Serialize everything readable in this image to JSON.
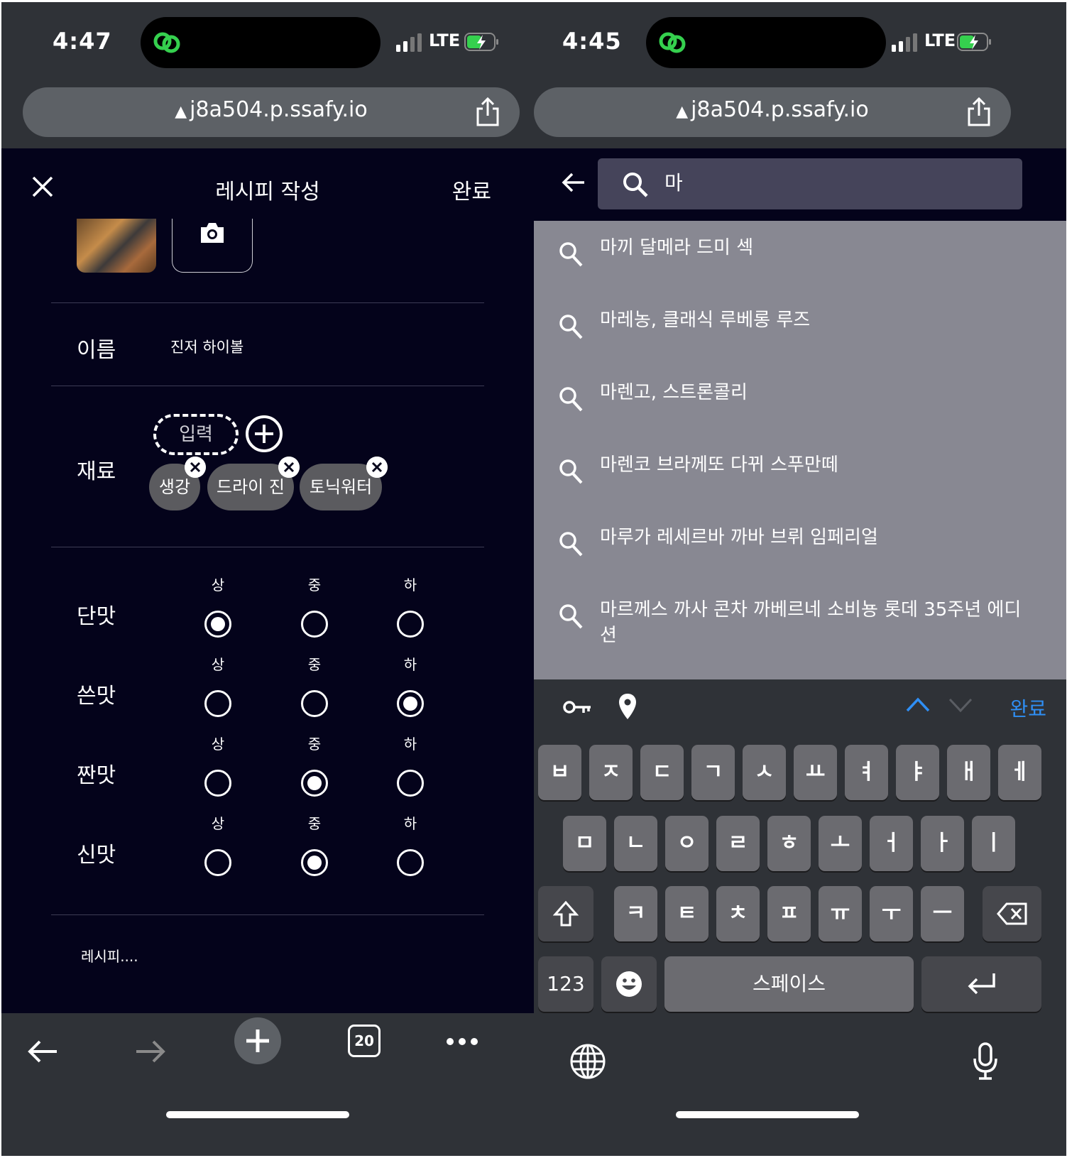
{
  "left": {
    "status": {
      "time": "4:47",
      "network": "LTE"
    },
    "url": {
      "domain": "j8a504.p.ssafy.io",
      "warning_icon": "▲"
    },
    "header": {
      "title": "레시피 작성",
      "done": "완료"
    },
    "form": {
      "name_label": "이름",
      "name_value": "진저 하이볼",
      "ingredients_label": "재료",
      "ingredient_input_placeholder": "입력",
      "ingredients": [
        "생강",
        "드라이 진",
        "토닉워터"
      ],
      "taste_levels": [
        "상",
        "중",
        "하"
      ],
      "tastes": [
        {
          "label": "단맛",
          "selected": "상"
        },
        {
          "label": "쓴맛",
          "selected": "하"
        },
        {
          "label": "짠맛",
          "selected": "중"
        },
        {
          "label": "신맛",
          "selected": "중"
        }
      ],
      "recipe_placeholder": "레시피...."
    },
    "bottom": {
      "tab_count": "20"
    }
  },
  "right": {
    "status": {
      "time": "4:45",
      "network": "LTE"
    },
    "url": {
      "domain": "j8a504.p.ssafy.io",
      "warning_icon": "▲"
    },
    "search": {
      "value": "마"
    },
    "suggestions": [
      "마끼 달메라 드미 섹",
      "마레농, 클래식 루베롱 루즈",
      "마렌고, 스트론콜리",
      "마렌코 브라께또 다뀌 스푸만떼",
      "마루가 레세르바 까바 브뤼 임페리얼",
      "마르께스 까사 콘차 까베르네 소비뇽 롯데 35주년 에디션"
    ],
    "keyboard": {
      "toolbar_done": "완료",
      "row1": [
        "ㅂ",
        "ㅈ",
        "ㄷ",
        "ㄱ",
        "ㅅ",
        "ㅛ",
        "ㅕ",
        "ㅑ",
        "ㅐ",
        "ㅔ"
      ],
      "row2": [
        "ㅁ",
        "ㄴ",
        "ㅇ",
        "ㄹ",
        "ㅎ",
        "ㅗ",
        "ㅓ",
        "ㅏ",
        "ㅣ"
      ],
      "row3": [
        "ㅋ",
        "ㅌ",
        "ㅊ",
        "ㅍ",
        "ㅠ",
        "ㅜ",
        "ㅡ"
      ],
      "numbers_key": "123",
      "space_key": "스페이스"
    }
  },
  "colors": {
    "app_bg": "#04031b",
    "chrome_bg": "#2f3237",
    "accent_green": "#35d04e",
    "link_blue": "#2f8ff5"
  }
}
